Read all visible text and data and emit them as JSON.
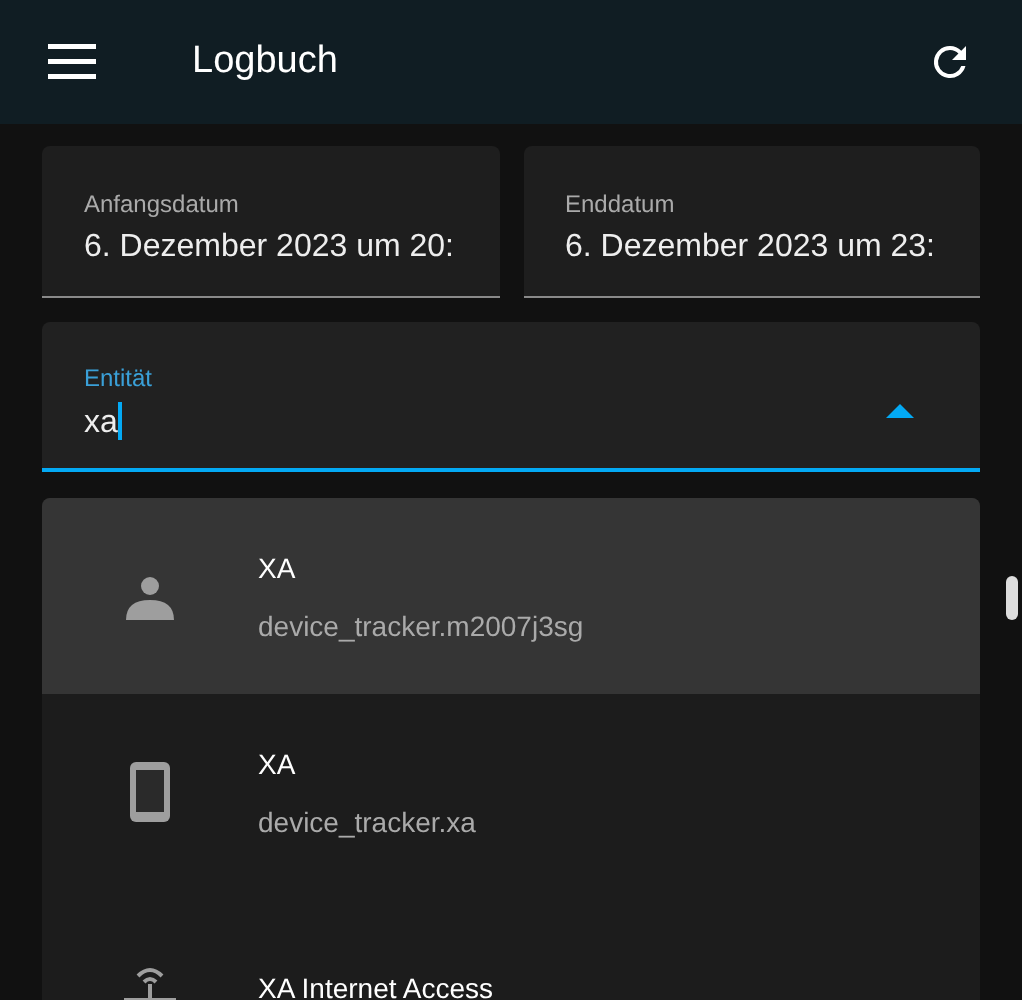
{
  "header": {
    "title": "Logbuch"
  },
  "dates": [
    {
      "label": "Anfangsdatum",
      "value": "6. Dezember 2023 um 20:"
    },
    {
      "label": "Enddatum",
      "value": "6. Dezember 2023 um 23:"
    }
  ],
  "entity_field": {
    "label": "Entität",
    "value": "xa",
    "expanded": true
  },
  "options": [
    {
      "kind": "person",
      "primary": "XA",
      "secondary": "device_tracker.m2007j3sg",
      "selected": true
    },
    {
      "kind": "phone",
      "primary": "XA",
      "secondary": "device_tracker.xa",
      "selected": false
    },
    {
      "kind": "router",
      "primary": "XA Internet Access",
      "selected": false
    }
  ]
}
